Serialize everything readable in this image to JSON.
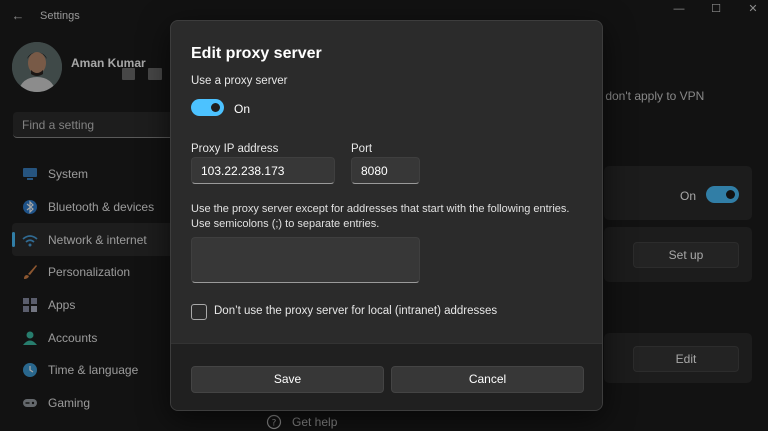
{
  "window": {
    "title": "Settings",
    "controls": {
      "minimize": "—",
      "maximize": "☐",
      "close": "✕"
    }
  },
  "user": {
    "name": "Aman Kumar"
  },
  "search": {
    "placeholder": "Find a setting"
  },
  "sidebar": {
    "items": [
      {
        "label": "System",
        "icon": "monitor-icon",
        "color": "#3b82c4"
      },
      {
        "label": "Bluetooth & devices",
        "icon": "bluetooth-icon",
        "color": "#2f7fd1"
      },
      {
        "label": "Network & internet",
        "icon": "wifi-icon",
        "color": "#4aa3e0",
        "active": true
      },
      {
        "label": "Personalization",
        "icon": "brush-icon",
        "color": "#d9864a"
      },
      {
        "label": "Apps",
        "icon": "apps-icon",
        "color": "#8a8fa6"
      },
      {
        "label": "Accounts",
        "icon": "person-icon",
        "color": "#3cc0a8"
      },
      {
        "label": "Time & language",
        "icon": "globe-clock-icon",
        "color": "#3f9fd9"
      },
      {
        "label": "Gaming",
        "icon": "gamepad-icon",
        "color": "#9aa0a6"
      }
    ]
  },
  "main": {
    "vpn_note": "s don't apply to VPN",
    "auto_detect_state": "On",
    "setup_button": "Set up",
    "edit_button": "Edit",
    "get_help": "Get help"
  },
  "dialog": {
    "title": "Edit proxy server",
    "use_proxy_label": "Use a proxy server",
    "toggle_state": "On",
    "ip_label": "Proxy IP address",
    "ip_value": "103.22.238.173",
    "port_label": "Port",
    "port_value": "8080",
    "exceptions_text_line1": "Use the proxy server except for addresses that start with the following entries.",
    "exceptions_text_line2": "Use semicolons (;) to separate entries.",
    "exceptions_value": "",
    "local_checkbox_label": "Don’t use the proxy server for local (intranet) addresses",
    "local_checkbox_checked": false,
    "save_label": "Save",
    "cancel_label": "Cancel"
  },
  "colors": {
    "accent": "#4cc2ff",
    "background": "#1c1c1c",
    "dialog": "#2b2b2b"
  }
}
